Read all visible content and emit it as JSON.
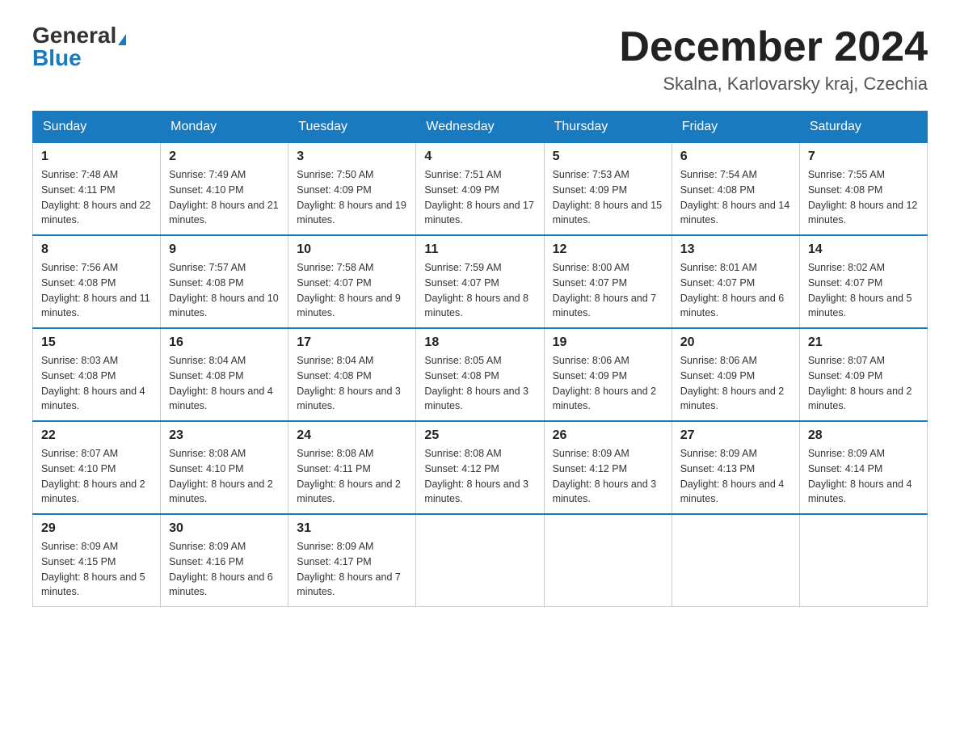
{
  "logo": {
    "general": "General",
    "blue": "Blue"
  },
  "header": {
    "month_year": "December 2024",
    "location": "Skalna, Karlovarsky kraj, Czechia"
  },
  "days_of_week": [
    "Sunday",
    "Monday",
    "Tuesday",
    "Wednesday",
    "Thursday",
    "Friday",
    "Saturday"
  ],
  "weeks": [
    [
      {
        "day": "1",
        "sunrise": "7:48 AM",
        "sunset": "4:11 PM",
        "daylight": "8 hours and 22 minutes."
      },
      {
        "day": "2",
        "sunrise": "7:49 AM",
        "sunset": "4:10 PM",
        "daylight": "8 hours and 21 minutes."
      },
      {
        "day": "3",
        "sunrise": "7:50 AM",
        "sunset": "4:09 PM",
        "daylight": "8 hours and 19 minutes."
      },
      {
        "day": "4",
        "sunrise": "7:51 AM",
        "sunset": "4:09 PM",
        "daylight": "8 hours and 17 minutes."
      },
      {
        "day": "5",
        "sunrise": "7:53 AM",
        "sunset": "4:09 PM",
        "daylight": "8 hours and 15 minutes."
      },
      {
        "day": "6",
        "sunrise": "7:54 AM",
        "sunset": "4:08 PM",
        "daylight": "8 hours and 14 minutes."
      },
      {
        "day": "7",
        "sunrise": "7:55 AM",
        "sunset": "4:08 PM",
        "daylight": "8 hours and 12 minutes."
      }
    ],
    [
      {
        "day": "8",
        "sunrise": "7:56 AM",
        "sunset": "4:08 PM",
        "daylight": "8 hours and 11 minutes."
      },
      {
        "day": "9",
        "sunrise": "7:57 AM",
        "sunset": "4:08 PM",
        "daylight": "8 hours and 10 minutes."
      },
      {
        "day": "10",
        "sunrise": "7:58 AM",
        "sunset": "4:07 PM",
        "daylight": "8 hours and 9 minutes."
      },
      {
        "day": "11",
        "sunrise": "7:59 AM",
        "sunset": "4:07 PM",
        "daylight": "8 hours and 8 minutes."
      },
      {
        "day": "12",
        "sunrise": "8:00 AM",
        "sunset": "4:07 PM",
        "daylight": "8 hours and 7 minutes."
      },
      {
        "day": "13",
        "sunrise": "8:01 AM",
        "sunset": "4:07 PM",
        "daylight": "8 hours and 6 minutes."
      },
      {
        "day": "14",
        "sunrise": "8:02 AM",
        "sunset": "4:07 PM",
        "daylight": "8 hours and 5 minutes."
      }
    ],
    [
      {
        "day": "15",
        "sunrise": "8:03 AM",
        "sunset": "4:08 PM",
        "daylight": "8 hours and 4 minutes."
      },
      {
        "day": "16",
        "sunrise": "8:04 AM",
        "sunset": "4:08 PM",
        "daylight": "8 hours and 4 minutes."
      },
      {
        "day": "17",
        "sunrise": "8:04 AM",
        "sunset": "4:08 PM",
        "daylight": "8 hours and 3 minutes."
      },
      {
        "day": "18",
        "sunrise": "8:05 AM",
        "sunset": "4:08 PM",
        "daylight": "8 hours and 3 minutes."
      },
      {
        "day": "19",
        "sunrise": "8:06 AM",
        "sunset": "4:09 PM",
        "daylight": "8 hours and 2 minutes."
      },
      {
        "day": "20",
        "sunrise": "8:06 AM",
        "sunset": "4:09 PM",
        "daylight": "8 hours and 2 minutes."
      },
      {
        "day": "21",
        "sunrise": "8:07 AM",
        "sunset": "4:09 PM",
        "daylight": "8 hours and 2 minutes."
      }
    ],
    [
      {
        "day": "22",
        "sunrise": "8:07 AM",
        "sunset": "4:10 PM",
        "daylight": "8 hours and 2 minutes."
      },
      {
        "day": "23",
        "sunrise": "8:08 AM",
        "sunset": "4:10 PM",
        "daylight": "8 hours and 2 minutes."
      },
      {
        "day": "24",
        "sunrise": "8:08 AM",
        "sunset": "4:11 PM",
        "daylight": "8 hours and 2 minutes."
      },
      {
        "day": "25",
        "sunrise": "8:08 AM",
        "sunset": "4:12 PM",
        "daylight": "8 hours and 3 minutes."
      },
      {
        "day": "26",
        "sunrise": "8:09 AM",
        "sunset": "4:12 PM",
        "daylight": "8 hours and 3 minutes."
      },
      {
        "day": "27",
        "sunrise": "8:09 AM",
        "sunset": "4:13 PM",
        "daylight": "8 hours and 4 minutes."
      },
      {
        "day": "28",
        "sunrise": "8:09 AM",
        "sunset": "4:14 PM",
        "daylight": "8 hours and 4 minutes."
      }
    ],
    [
      {
        "day": "29",
        "sunrise": "8:09 AM",
        "sunset": "4:15 PM",
        "daylight": "8 hours and 5 minutes."
      },
      {
        "day": "30",
        "sunrise": "8:09 AM",
        "sunset": "4:16 PM",
        "daylight": "8 hours and 6 minutes."
      },
      {
        "day": "31",
        "sunrise": "8:09 AM",
        "sunset": "4:17 PM",
        "daylight": "8 hours and 7 minutes."
      },
      null,
      null,
      null,
      null
    ]
  ]
}
